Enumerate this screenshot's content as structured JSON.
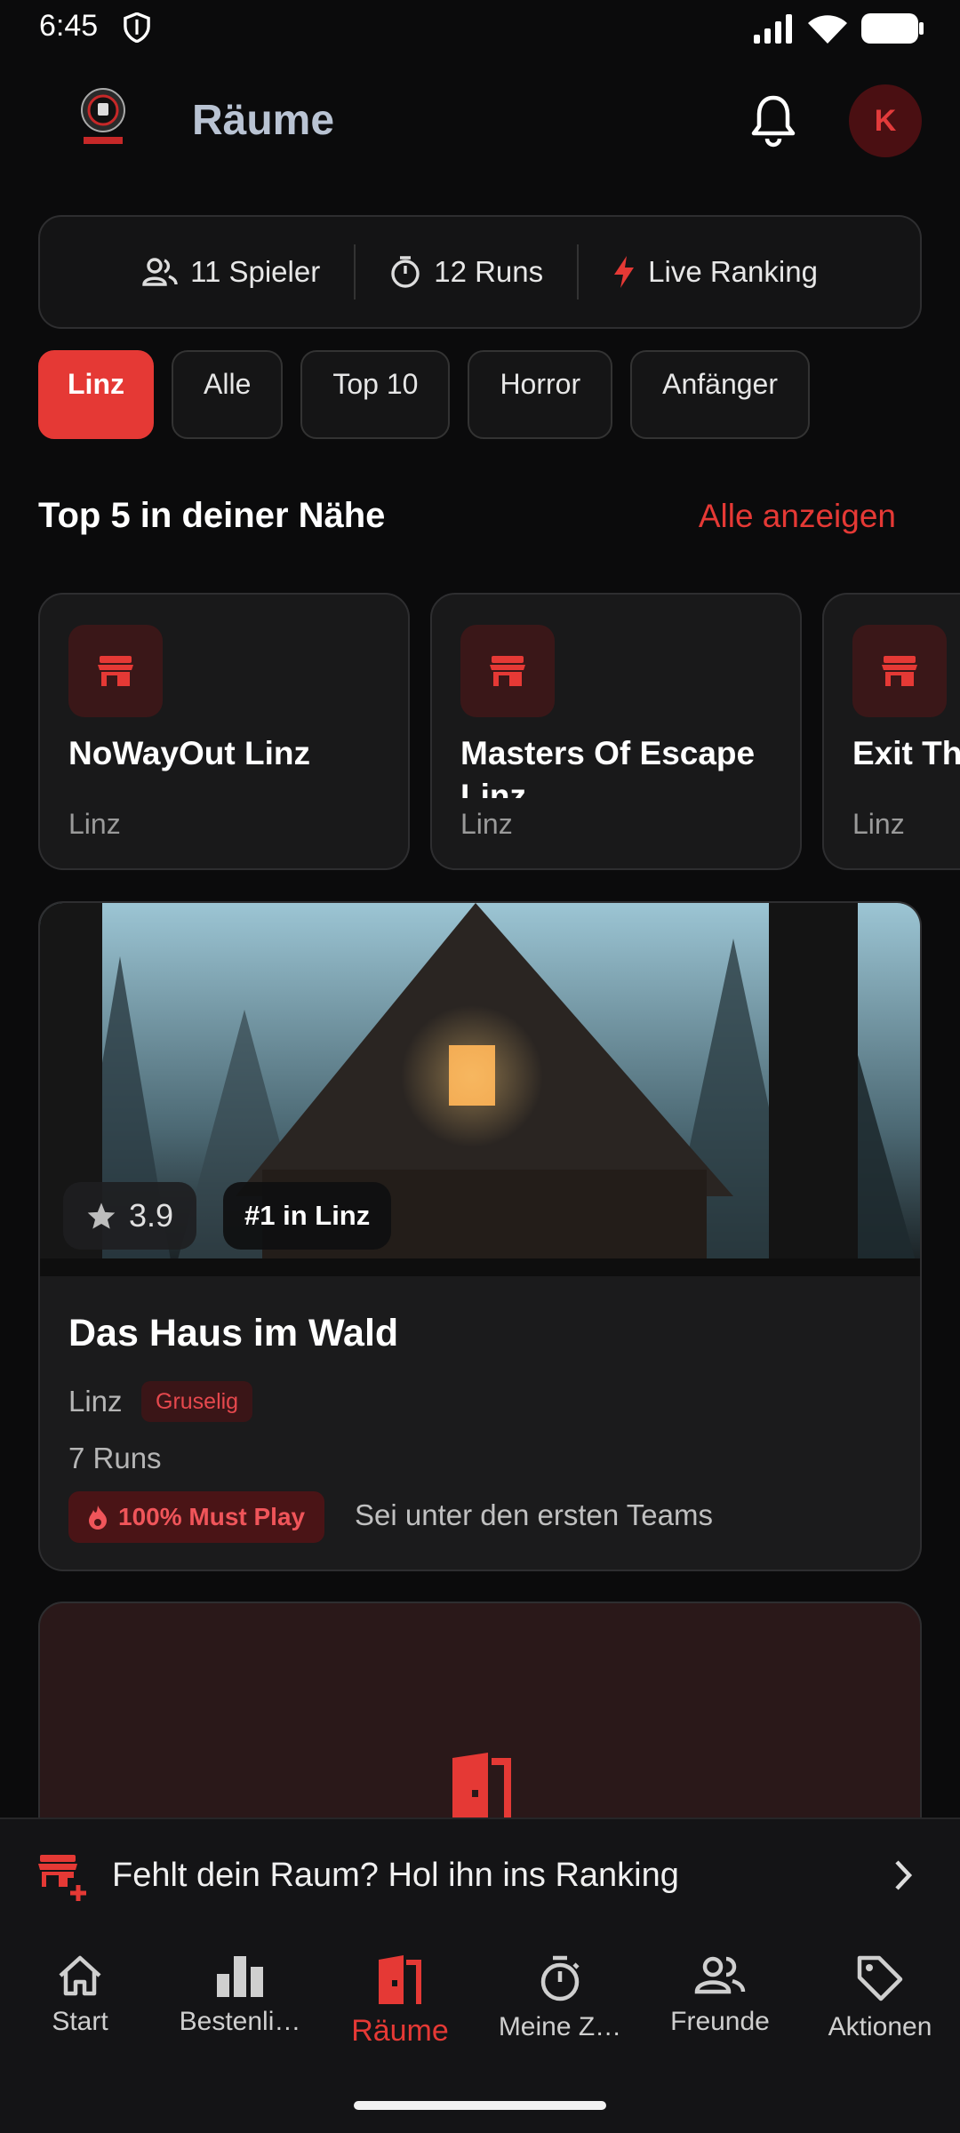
{
  "status": {
    "time": "6:45"
  },
  "header": {
    "title": "Räume",
    "avatar_initial": "K"
  },
  "stats": [
    {
      "icon": "people-icon",
      "label": "11 Spieler"
    },
    {
      "icon": "timer-icon",
      "label": "12 Runs"
    },
    {
      "icon": "bolt-icon",
      "label": "Live Ranking"
    }
  ],
  "filters": [
    "Linz",
    "Alle",
    "Top 10",
    "Horror",
    "Anfänger"
  ],
  "section": {
    "title": "Top 5 in deiner Nähe",
    "link": "Alle anzeigen"
  },
  "nearby": [
    {
      "name": "NoWayOut Linz",
      "city": "Linz"
    },
    {
      "name": "Masters Of Escape Linz",
      "city": "Linz"
    },
    {
      "name": "Exit Th",
      "city": "Linz"
    }
  ],
  "room": {
    "rating": "3.9",
    "rank_badge": "#1 in Linz",
    "name": "Das Haus im Wald",
    "city": "Linz",
    "genre": "Gruselig",
    "runs": "7 Runs",
    "must_play": "100% Must Play",
    "hint": "Sei unter den ersten Teams"
  },
  "banner": {
    "text": "Fehlt dein Raum? Hol ihn ins Ranking"
  },
  "nav": [
    {
      "icon": "home-icon",
      "label": "Start"
    },
    {
      "icon": "leaderboard-icon",
      "label": "Bestenli…"
    },
    {
      "icon": "door-icon",
      "label": "Räume"
    },
    {
      "icon": "stopwatch-icon",
      "label": "Meine Z…"
    },
    {
      "icon": "friends-icon",
      "label": "Freunde"
    },
    {
      "icon": "tag-icon",
      "label": "Aktionen"
    }
  ],
  "colors": {
    "accent": "#e53935",
    "background": "#0b0b0c",
    "card": "#1b1b1c"
  }
}
